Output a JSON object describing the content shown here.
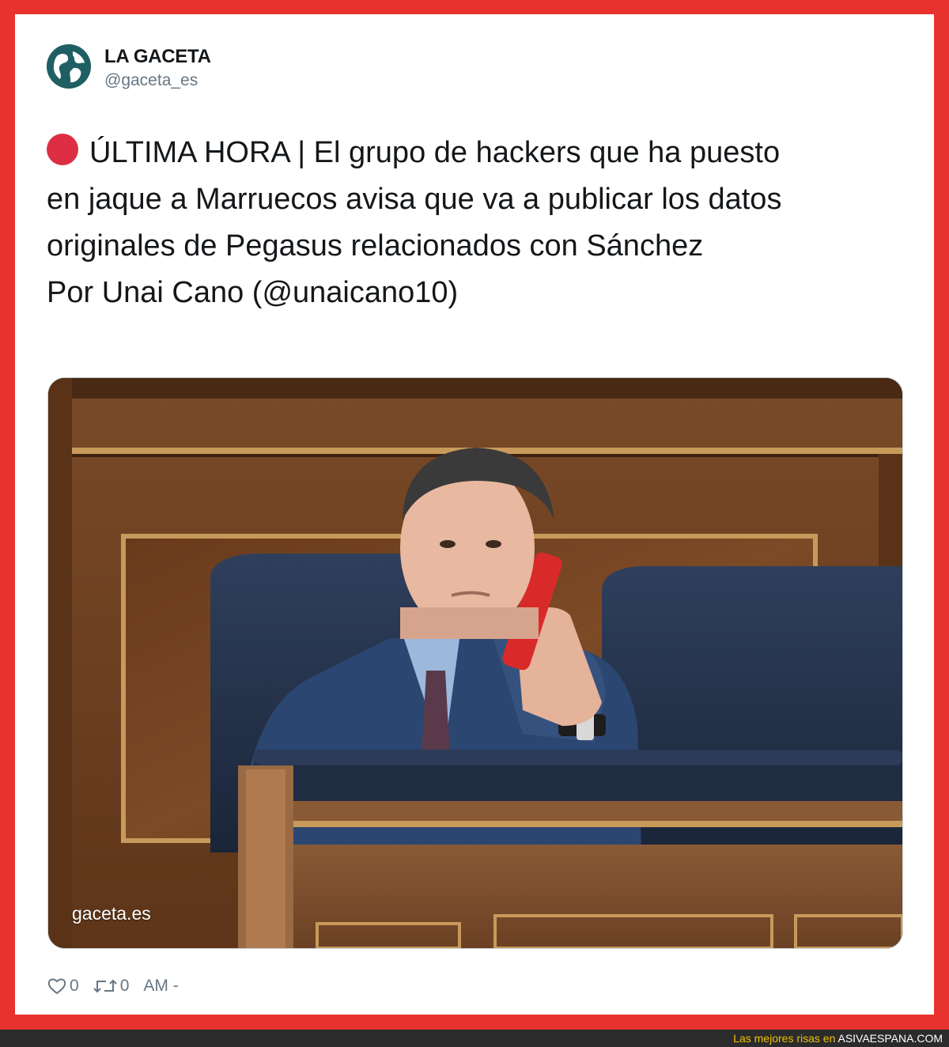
{
  "tweet": {
    "author_name": "LA GACETA",
    "author_handle": "@gaceta_es",
    "text_lines": [
      "ÚLTIMA HORA | El grupo de hackers que ha puesto",
      "en jaque a Marruecos avisa que va a publicar los datos",
      "originales de Pegasus relacionados con Sánchez",
      "Por Unai Cano (@unaicano10)"
    ],
    "media_watermark": "gaceta.es",
    "like_count": "0",
    "retweet_count": "0",
    "timestamp": "AM -"
  },
  "footer": {
    "prefix": "Las mejores risas en ",
    "site": "ASIVAESPANA.COM"
  },
  "colors": {
    "frame": "#e8322d",
    "avatar": "#1f5f63",
    "breaking_dot": "#dd2e44",
    "footer_text": "#f2c200"
  },
  "icons": [
    "globe-icon",
    "red-circle-icon",
    "heart-icon",
    "retweet-icon"
  ]
}
